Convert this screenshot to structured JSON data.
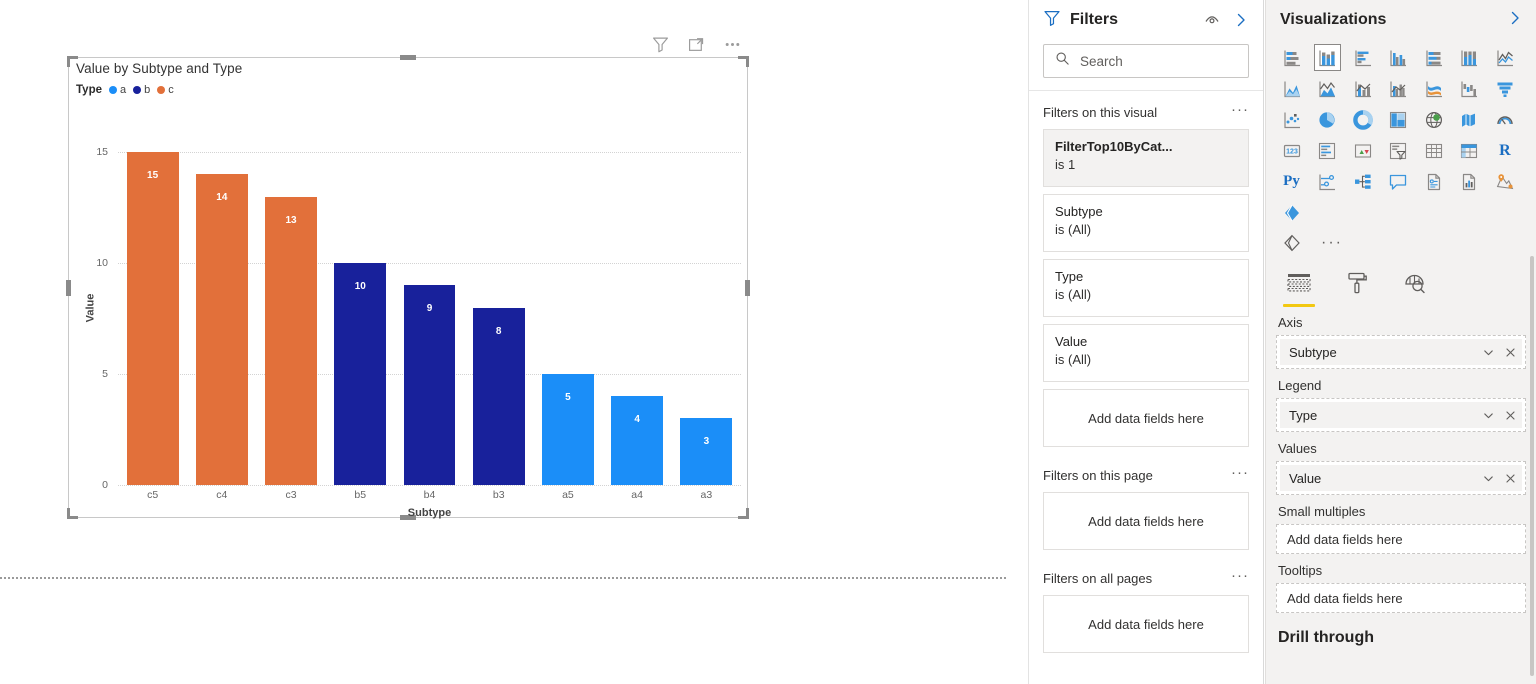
{
  "visual": {
    "title": "Value by Subtype and Type",
    "toolbar": [
      {
        "name": "filter-icon",
        "label": "Filter"
      },
      {
        "name": "focus-mode-icon",
        "label": "Focus mode"
      },
      {
        "name": "more-options-icon",
        "label": "More options"
      }
    ]
  },
  "chart_data": {
    "type": "bar",
    "title": "Value by Subtype and Type",
    "xlabel": "Subtype",
    "ylabel": "Value",
    "categories": [
      "c5",
      "c4",
      "c3",
      "b5",
      "b4",
      "b3",
      "a5",
      "a4",
      "a3"
    ],
    "values": [
      15,
      14,
      13,
      10,
      9,
      8,
      5,
      4,
      3
    ],
    "point_colors": [
      "#E2703A",
      "#E2703A",
      "#E2703A",
      "#18219B",
      "#18219B",
      "#18219B",
      "#1B8EF8",
      "#1B8EF8",
      "#1B8EF8"
    ],
    "point_series": [
      "c",
      "c",
      "c",
      "b",
      "b",
      "b",
      "a",
      "a",
      "a"
    ],
    "ylim": [
      0,
      16
    ],
    "yticks": [
      0,
      5,
      10,
      15
    ],
    "ytick_labels": [
      "0",
      "5",
      "10",
      "15"
    ],
    "grid": true,
    "legend_title": "Type",
    "legend_position": "top",
    "series": [
      {
        "name": "a",
        "color": "#1B8EF8",
        "categories": [
          "a5",
          "a4",
          "a3"
        ],
        "values": [
          5,
          4,
          3
        ]
      },
      {
        "name": "b",
        "color": "#18219B",
        "categories": [
          "b5",
          "b4",
          "b3"
        ],
        "values": [
          10,
          9,
          8
        ]
      },
      {
        "name": "c",
        "color": "#E2703A",
        "categories": [
          "c5",
          "c4",
          "c3"
        ],
        "values": [
          15,
          14,
          13
        ]
      }
    ],
    "data_labels": [
      "15",
      "14",
      "13",
      "10",
      "9",
      "8",
      "5",
      "4",
      "3"
    ]
  },
  "filters_pane": {
    "title": "Filters",
    "header_icons": [
      {
        "name": "hide-pane-eye-icon",
        "label": "Hide filter pane"
      },
      {
        "name": "collapse-chevron-icon",
        "label": "Collapse"
      }
    ],
    "search": {
      "placeholder": "Search",
      "value": ""
    },
    "groups": [
      {
        "title": "Filters on this visual",
        "ellipsis": "···",
        "cards": [
          {
            "name": "FilterTop10ByCat...",
            "condition": "is 1",
            "active": true
          },
          {
            "name": "Subtype",
            "condition": "is (All)",
            "active": false
          },
          {
            "name": "Type",
            "condition": "is (All)",
            "active": false
          },
          {
            "name": "Value",
            "condition": "is (All)",
            "active": false
          }
        ],
        "dropzone": "Add data fields here"
      },
      {
        "title": "Filters on this page",
        "ellipsis": "···",
        "cards": [],
        "dropzone": "Add data fields here"
      },
      {
        "title": "Filters on all pages",
        "ellipsis": "···",
        "cards": [],
        "dropzone": "Add data fields here"
      }
    ]
  },
  "visualizations_pane": {
    "title": "Visualizations",
    "collapse_icon": "chevron-right-icon",
    "gallery": [
      {
        "name": "stacked-bar-chart-icon",
        "selected": false
      },
      {
        "name": "stacked-column-chart-icon",
        "selected": true
      },
      {
        "name": "clustered-bar-chart-icon",
        "selected": false
      },
      {
        "name": "clustered-column-chart-icon",
        "selected": false
      },
      {
        "name": "hundred-percent-stacked-bar-chart-icon",
        "selected": false
      },
      {
        "name": "hundred-percent-stacked-column-chart-icon",
        "selected": false
      },
      {
        "name": "line-chart-icon",
        "selected": false
      },
      {
        "name": "area-chart-icon",
        "selected": false
      },
      {
        "name": "stacked-area-chart-icon",
        "selected": false
      },
      {
        "name": "line-and-stacked-column-chart-icon",
        "selected": false
      },
      {
        "name": "line-and-clustered-column-chart-icon",
        "selected": false
      },
      {
        "name": "ribbon-chart-icon",
        "selected": false
      },
      {
        "name": "waterfall-chart-icon",
        "selected": false
      },
      {
        "name": "funnel-chart-icon",
        "selected": false
      },
      {
        "name": "scatter-chart-icon",
        "selected": false
      },
      {
        "name": "pie-chart-icon",
        "selected": false
      },
      {
        "name": "donut-chart-icon",
        "selected": false
      },
      {
        "name": "treemap-icon",
        "selected": false
      },
      {
        "name": "map-icon",
        "selected": false
      },
      {
        "name": "filled-map-icon",
        "selected": false
      },
      {
        "name": "gauge-icon",
        "selected": false
      },
      {
        "name": "card-icon",
        "selected": false
      },
      {
        "name": "multi-row-card-icon",
        "selected": false
      },
      {
        "name": "kpi-icon",
        "selected": false
      },
      {
        "name": "slicer-icon",
        "selected": false
      },
      {
        "name": "table-icon",
        "selected": false
      },
      {
        "name": "matrix-icon",
        "selected": false
      },
      {
        "name": "r-script-visual-icon",
        "selected": false
      },
      {
        "name": "python-visual-icon",
        "selected": false
      },
      {
        "name": "key-influencers-icon",
        "selected": false
      },
      {
        "name": "decomposition-tree-icon",
        "selected": false
      },
      {
        "name": "qna-icon",
        "selected": false
      },
      {
        "name": "smart-narrative-icon",
        "selected": false
      },
      {
        "name": "paginated-report-icon",
        "selected": false
      },
      {
        "name": "arcgis-maps-icon",
        "selected": false
      },
      {
        "name": "power-apps-icon",
        "selected": false
      }
    ],
    "gallery_ellipsis": "···",
    "tabs": [
      {
        "name": "tab-fields",
        "icon": "fields-table-icon",
        "selected": true
      },
      {
        "name": "tab-format",
        "icon": "paint-roller-icon",
        "selected": false
      },
      {
        "name": "tab-analytics",
        "icon": "analytics-magnifier-icon",
        "selected": false
      }
    ],
    "wells": [
      {
        "label": "Axis",
        "type": "chip",
        "value": "Subtype"
      },
      {
        "label": "Legend",
        "type": "chip",
        "value": "Type"
      },
      {
        "label": "Values",
        "type": "chip",
        "value": "Value"
      },
      {
        "label": "Small multiples",
        "type": "drop",
        "value": "Add data fields here"
      },
      {
        "label": "Tooltips",
        "type": "drop",
        "value": "Add data fields here"
      }
    ],
    "drill_through": "Drill through",
    "accent_color": "#F2C811"
  }
}
